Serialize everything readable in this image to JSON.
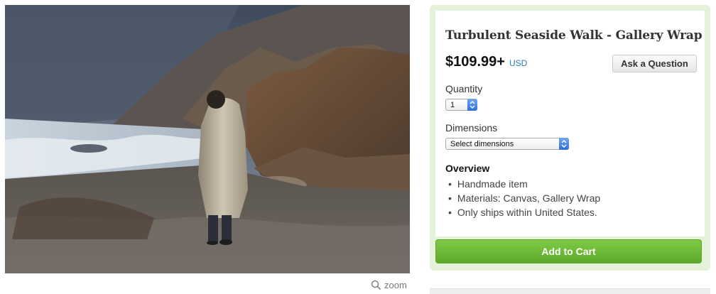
{
  "product": {
    "title": "Turbulent Seaside Walk - Gallery Wrap",
    "price": "$109.99+",
    "currency": "USD",
    "ask_question_label": "Ask a Question",
    "quantity": {
      "label": "Quantity",
      "selected": "1"
    },
    "dimensions": {
      "label": "Dimensions",
      "selected": "Select dimensions"
    },
    "overview": {
      "heading": "Overview",
      "items": [
        "Handmade item",
        "Materials: Canvas, Gallery Wrap",
        "Only ships within United States."
      ]
    },
    "add_to_cart_label": "Add to Cart"
  },
  "image": {
    "zoom_label": "zoom",
    "zoom_icon": "magnifier-icon"
  },
  "colors": {
    "panel_bg": "#e3f2d9",
    "cart_green": "#6ab836",
    "currency_blue": "#2a7ab8"
  }
}
